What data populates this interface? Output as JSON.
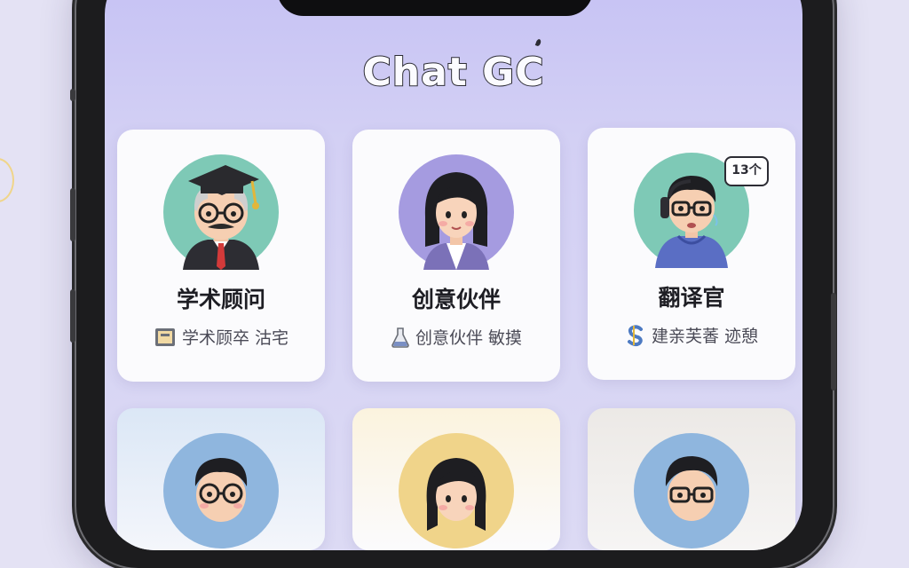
{
  "app": {
    "title": "Chat GC"
  },
  "cards": [
    {
      "title": "学术顾问",
      "subtitle": "学术顾卒 沽宅",
      "avatar": "professor-avatar-icon",
      "badge_icon": "book-icon",
      "avatar_bg": "#7ec9b6"
    },
    {
      "title": "创意伙伴",
      "subtitle": "创意伙伴 敏摸",
      "avatar": "woman-avatar-icon",
      "badge_icon": "flask-icon",
      "avatar_bg": "#a59be0"
    },
    {
      "title": "翻译官",
      "subtitle": "建亲芙萫 迹憩",
      "avatar": "translator-avatar-icon",
      "badge_icon": "s-letter-icon",
      "avatar_bg": "#7ec9b6",
      "speech_bubble": "13个"
    }
  ],
  "colors": {
    "screen_bg": "#c5c1f4",
    "card_bg": "#fbfbfd",
    "accent": "#7ec9b6"
  }
}
